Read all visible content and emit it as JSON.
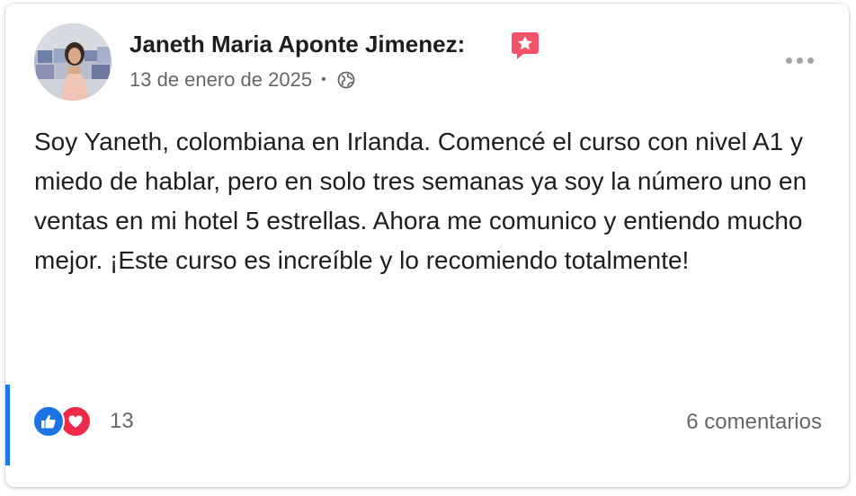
{
  "post": {
    "author": "Janeth Maria Aponte Jimenez:",
    "date": "13 de enero de 2025",
    "separator": "•",
    "body": "Soy Yaneth, colombiana en Irlanda. Comencé el curso con nivel A1 y miedo de hablar, pero en solo tres semanas ya soy la número uno en ventas en mi hotel 5 estrellas. Ahora me comunico y entiendo mucho mejor. ¡Este curso es increíble y lo recomiendo totalmente!",
    "reaction_count": "13",
    "comments_label": "6 comentarios"
  },
  "icons": {
    "badge": "top-fan-star-badge-icon",
    "visibility": "globe-icon",
    "more": "more-options-icon",
    "reactions": [
      "like-icon",
      "love-icon"
    ]
  },
  "colors": {
    "accent": "#1877f2",
    "badge": "#f35369",
    "like": "#1b74e4",
    "love": "#f02849",
    "secondary_text": "#65676b"
  }
}
